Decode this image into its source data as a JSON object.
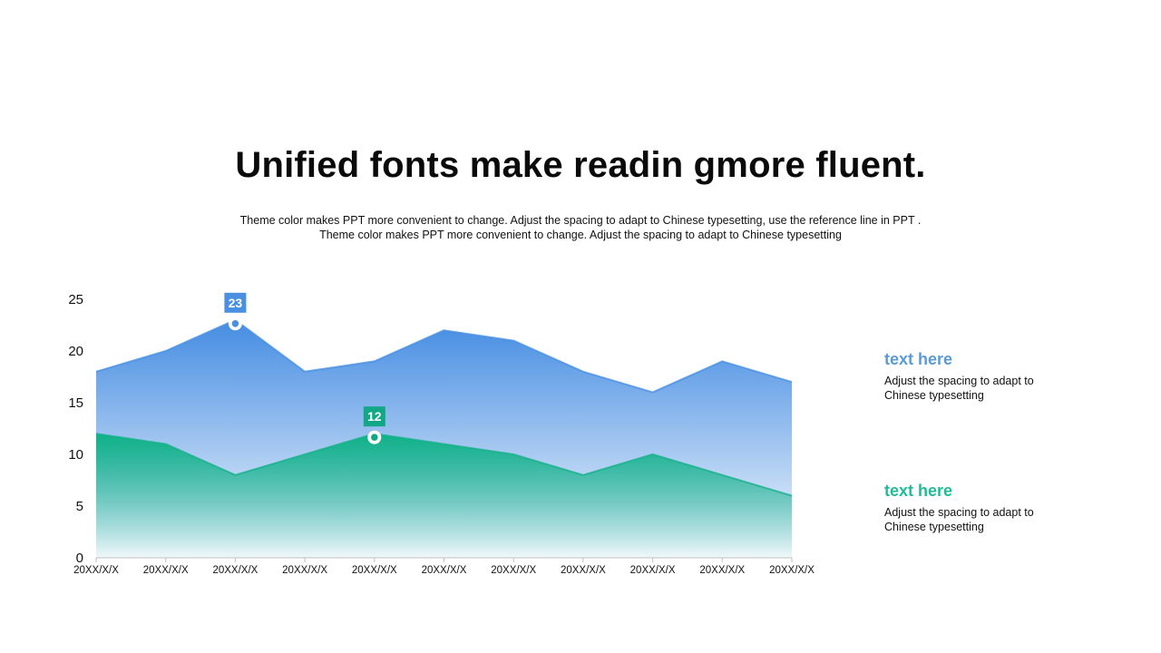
{
  "title": "Unified fonts make readin gmore fluent.",
  "subtitle_lines": [
    "Theme color makes PPT more convenient  to change. Adjust  the spacing  to adapt to Chinese  typesetting, use the reference line in PPT .",
    "Theme  color makes PPT more convenient  to change. Adjust the spacing to adapt to Chinese  typesetting"
  ],
  "legend": [
    {
      "title": "text here",
      "desc_lines": [
        "Adjust the spacing to adapt to",
        "Chinese  typesetting"
      ],
      "color": "#5b9bd5"
    },
    {
      "title": "text here",
      "desc_lines": [
        "Adjust the spacing to adapt to",
        "Chinese  typesetting"
      ],
      "color": "#1fbc98"
    }
  ],
  "chart_data": {
    "type": "area",
    "x": [
      "20XX/X/X",
      "20XX/X/X",
      "20XX/X/X",
      "20XX/X/X",
      "20XX/X/X",
      "20XX/X/X",
      "20XX/X/X",
      "20XX/X/X",
      "20XX/X/X",
      "20XX/X/X",
      "20XX/X/X"
    ],
    "series": [
      {
        "values": [
          18,
          20,
          23,
          18,
          19,
          22,
          21,
          18,
          16,
          19,
          17
        ],
        "color": "#4a90e2"
      },
      {
        "values": [
          12,
          11,
          8,
          10,
          12,
          11,
          10,
          8,
          10,
          8,
          6
        ],
        "color": "#16b18a"
      }
    ],
    "ylim": [
      0,
      25
    ],
    "yticks": [
      0,
      5,
      10,
      15,
      20,
      25
    ],
    "grid": false,
    "annotations": [
      {
        "series": 0,
        "index": 2,
        "label": "23",
        "color": "#4a90e2"
      },
      {
        "series": 1,
        "index": 4,
        "label": "12",
        "color": "#12a886"
      }
    ]
  }
}
